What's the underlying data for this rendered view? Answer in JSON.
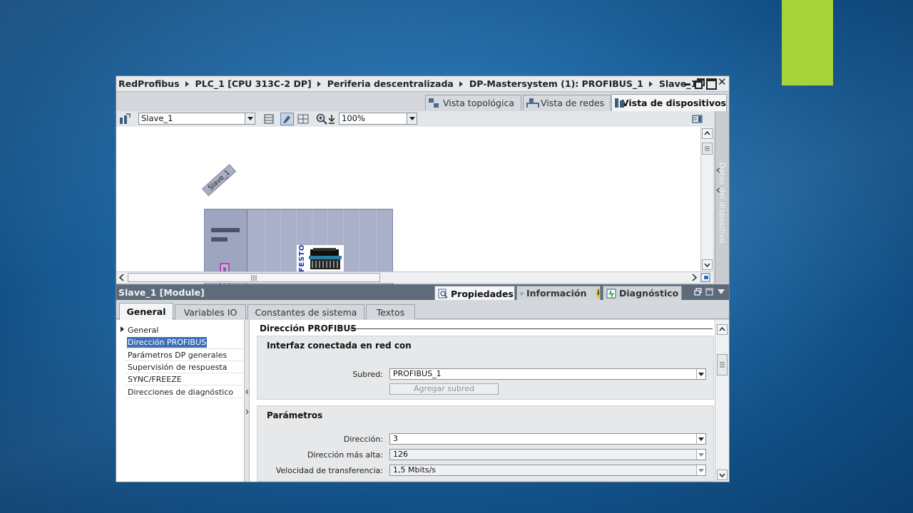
{
  "window": {
    "breadcrumb": [
      "RedProfibus",
      "PLC_1 [CPU 313C-2 DP]",
      "Periferia descentralizada",
      "DP-Mastersystem (1): PROFIBUS_1",
      "Slave_1"
    ],
    "controls": {
      "close_glyph": "✕"
    }
  },
  "view_tabs": [
    {
      "label": "Vista topológica",
      "icon": "topology-icon"
    },
    {
      "label": "Vista de redes",
      "icon": "network-icon"
    },
    {
      "label": "Vista de dispositivos",
      "icon": "device-icon",
      "active": true
    }
  ],
  "toolbar": {
    "device_select": "Slave_1",
    "zoom": "100%"
  },
  "canvas": {
    "slave_tag": "Slave_1",
    "module_brand": "FESTO"
  },
  "side_panel": {
    "label": "Datos del dispositivo"
  },
  "inspector": {
    "title": "Slave_1 [Module]",
    "tabs": [
      {
        "label": "Propiedades",
        "active": true
      },
      {
        "label": "Información"
      },
      {
        "label": "Diagnóstico"
      }
    ],
    "info_badge": "i"
  },
  "sub_tabs": [
    {
      "label": "General",
      "active": true
    },
    {
      "label": "Variables IO"
    },
    {
      "label": "Constantes de sistema"
    },
    {
      "label": "Textos"
    }
  ],
  "nav": {
    "items": [
      "General",
      "Dirección PROFIBUS",
      "Parámetros DP generales",
      "Supervisión de respuesta",
      "SYNC/FREEZE",
      "Direcciones de diagnóstico"
    ],
    "selected": 1
  },
  "content": {
    "section_title": "Dirección PROFIBUS",
    "group1": {
      "title": "Interfaz conectada en red con",
      "subnet_label": "Subred:",
      "subnet_value": "PROFIBUS_1",
      "add_subnet_button": "Agregar subred"
    },
    "group2": {
      "title": "Parámetros",
      "address_label": "Dirección:",
      "address_value": "3",
      "highest_label": "Dirección más alta:",
      "highest_value": "126",
      "speed_label": "Velocidad de transferencia:",
      "speed_value": "1,5 Mbits/s"
    }
  },
  "colors": {
    "accent_green": "#a6d23a",
    "inspector_bar": "#5d6b7a",
    "selection": "#3f6fb7",
    "module_purple": "#aab0c8"
  }
}
